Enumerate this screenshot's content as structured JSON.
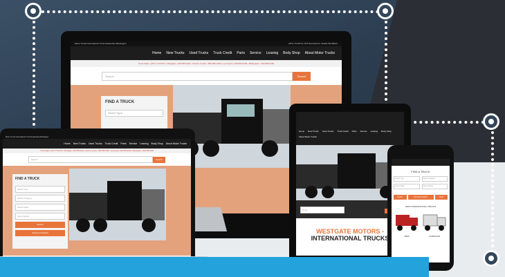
{
  "site": {
    "tagline": "Motor Trucks International Truck Dealership Washington",
    "contact": "(877) 772-8772 | 875 Riverside Dr, Seattle WA 98101",
    "nav": [
      "Home",
      "New Trucks",
      "Used Trucks",
      "Truck Credit",
      "Parts",
      "Service",
      "Leasing",
      "Body Shop",
      "About Motor Trucks"
    ],
    "ticker": "Truck Sales • (877) 772-8772 • Westgate • 425-555-0101 • Service Center • 800-555-0150 • Lynnwood • 425-555-0199 • Bellingham • 360-555-0156",
    "search_placeholder": "Search",
    "search_button": "Search",
    "find_title": "FIND A TRUCK",
    "select_type": "Select Type",
    "select_category": "Select Category",
    "select_make": "Select Make",
    "select_model": "Select Model",
    "search_btn": "Search",
    "advanced_search": "Advanced Search",
    "about_link": "About Motor Trucks",
    "filter_none": "None",
    "brand_line1": "WESTGATE MOTORS -",
    "brand_line2": "INTERNATIONAL TRUCKS",
    "new_international": "NEW INTERNATIONAL TRUCKS",
    "truck1": "9900i",
    "truck2": "LONESTAR",
    "clear": "Clear"
  },
  "colors": {
    "accent": "#e8743b",
    "blue": "#23a2dc",
    "dark": "#1d1d1d"
  }
}
